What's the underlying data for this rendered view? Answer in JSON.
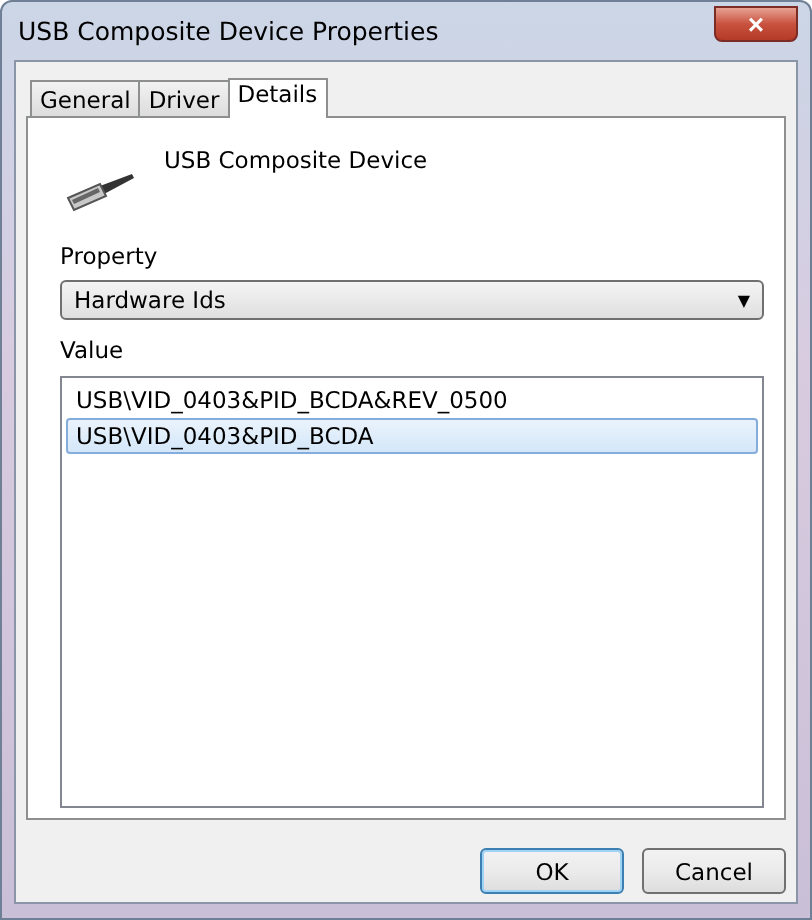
{
  "window": {
    "title": "USB Composite Device Properties",
    "close": "×"
  },
  "tabs": [
    {
      "label": "General",
      "selected": false
    },
    {
      "label": "Driver",
      "selected": false
    },
    {
      "label": "Details",
      "selected": true
    }
  ],
  "device": {
    "name": "USB Composite Device"
  },
  "property": {
    "label": "Property",
    "value": "Hardware Ids",
    "caret": "▼"
  },
  "value": {
    "label": "Value",
    "items": [
      {
        "text": "USB\\VID_0403&PID_BCDA&REV_0500",
        "selected": false
      },
      {
        "text": "USB\\VID_0403&PID_BCDA",
        "selected": true
      }
    ]
  },
  "buttons": [
    {
      "label": "OK",
      "default": true
    },
    {
      "label": "Cancel",
      "default": false
    }
  ]
}
